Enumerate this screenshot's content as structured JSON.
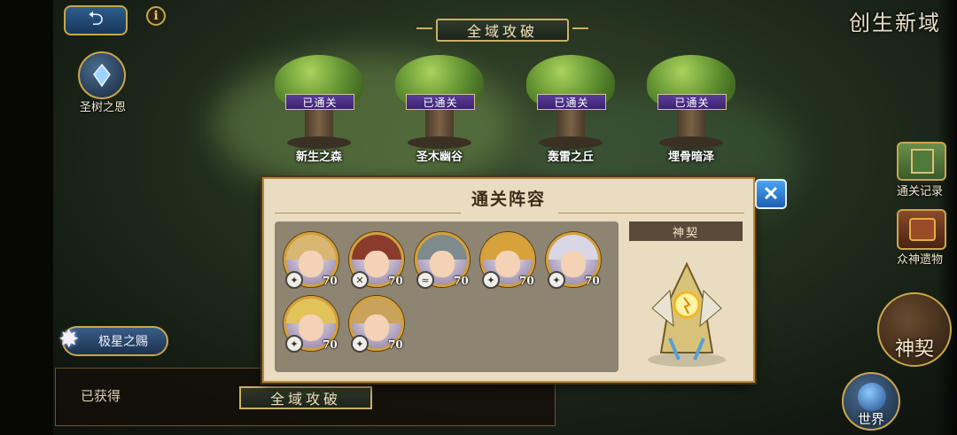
{
  "header": {
    "back_icon": "return-arrow-icon",
    "info_label": "i",
    "region_name": "创生新域"
  },
  "left_menu": {
    "tree_blessing": "圣树之恩",
    "star_gift": "极星之赐",
    "obtained": "已获得"
  },
  "right_menu": {
    "clear_record": "通关记录",
    "relics": "众神遗物",
    "contract": "神契",
    "world": "世界"
  },
  "banner": {
    "title": "全域攻破",
    "bottom_title": "全域攻破"
  },
  "stages": [
    {
      "name": "新生之森",
      "status": "已通关"
    },
    {
      "name": "圣木幽谷",
      "status": "已通关"
    },
    {
      "name": "轰雷之丘",
      "status": "已通关"
    },
    {
      "name": "埋骨暗泽",
      "status": "已通关"
    }
  ],
  "modal": {
    "title": "通关阵容",
    "close_icon": "close-x-icon",
    "contract_label": "神契",
    "heroes": [
      {
        "level": "70",
        "hair": "#d9b772",
        "badge": "✦"
      },
      {
        "level": "70",
        "hair": "#8a3b2b",
        "badge": "✕"
      },
      {
        "level": "70",
        "hair": "#7e8a8c",
        "badge": "≈"
      },
      {
        "level": "70",
        "hair": "#d8a23a",
        "badge": "✦"
      },
      {
        "level": "70",
        "hair": "#d9d6e6",
        "badge": "✦"
      },
      {
        "level": "70",
        "hair": "#e2c35a",
        "badge": "✦"
      },
      {
        "level": "70",
        "hair": "#c9a35a",
        "badge": "✦"
      }
    ]
  },
  "colors": {
    "accent_gold": "#c9a64b",
    "cleared_purple": "#4a2f86",
    "close_blue": "#2a7bd6"
  }
}
